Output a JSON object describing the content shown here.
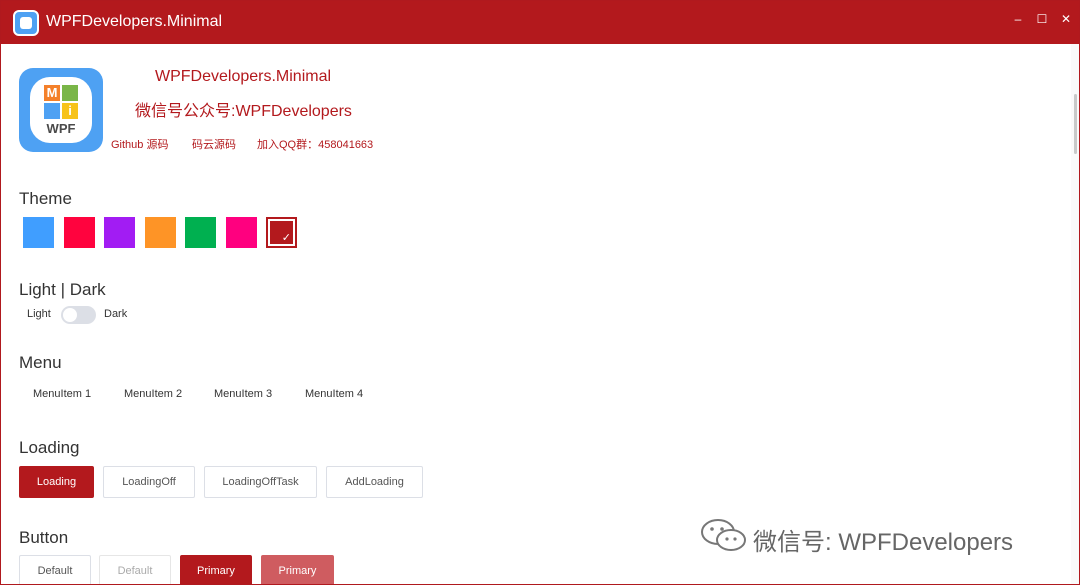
{
  "window": {
    "title": "WPFDevelopers.Minimal",
    "controls": {
      "minimize": "–",
      "maximize": "☐",
      "close": "✕"
    },
    "accent": "#b3191d"
  },
  "header": {
    "app_name": "WPFDevelopers.Minimal",
    "wechat": "微信号公众号:WPFDevelopers",
    "links": [
      "Github 源码",
      "码云源码",
      "加入QQ群：458041663"
    ],
    "logo_text": "WPF",
    "logo_letters": [
      "M",
      "i"
    ]
  },
  "theme": {
    "heading": "Theme",
    "swatches": [
      "#409eff",
      "#ff033e",
      "#a21cf3",
      "#fe9426",
      "#00b050",
      "#ff007f",
      "#b3191d"
    ],
    "selected_index": 6
  },
  "light_dark": {
    "heading": "Light | Dark",
    "light_label": "Light",
    "dark_label": "Dark",
    "is_dark": false
  },
  "menu": {
    "heading": "Menu",
    "items": [
      "MenuItem 1",
      "MenuItem 2",
      "MenuItem 3",
      "MenuItem 4"
    ]
  },
  "loading": {
    "heading": "Loading",
    "buttons": [
      "Loading",
      "LoadingOff",
      "LoadingOffTask",
      "AddLoading"
    ]
  },
  "button": {
    "heading": "Button",
    "buttons": [
      "Default",
      "Default",
      "Primary",
      "Primary"
    ]
  },
  "watermark": {
    "text": "微信号: WPFDevelopers"
  }
}
